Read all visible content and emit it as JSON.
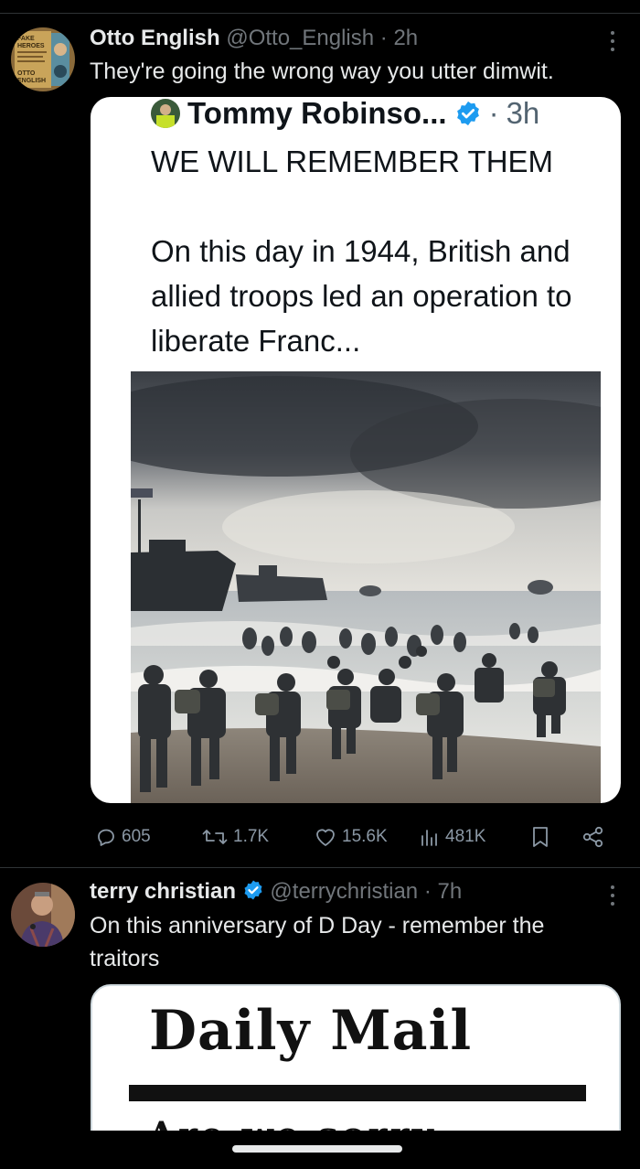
{
  "tweet1": {
    "name": "Otto English",
    "handle": "@Otto_English",
    "time": "2h",
    "text": "They're going the wrong way you utter dimwit.",
    "avatar_lines": [
      "FAKE",
      "HEROES",
      "OTTO",
      "ENGLISH"
    ],
    "quote": {
      "name": "Tommy Robinso...",
      "time": "3h",
      "text": "WE WILL REMEMBER THEM\n\nOn this day in 1944, British and allied troops led an operation to liberate Franc..."
    },
    "actions": {
      "replies": "605",
      "reposts": "1.7K",
      "likes": "15.6K",
      "views": "481K"
    }
  },
  "tweet2": {
    "name": "terry christian",
    "handle": "@terrychristian",
    "time": "7h",
    "text": "On this anniversary of D Day - remember the traitors",
    "image": {
      "masthead": "Daily Mail",
      "headline_peek": "Are we sorry"
    }
  },
  "colors": {
    "background": "#000000",
    "verified": "#1d9bf0",
    "secondary_text": "#71767b"
  }
}
